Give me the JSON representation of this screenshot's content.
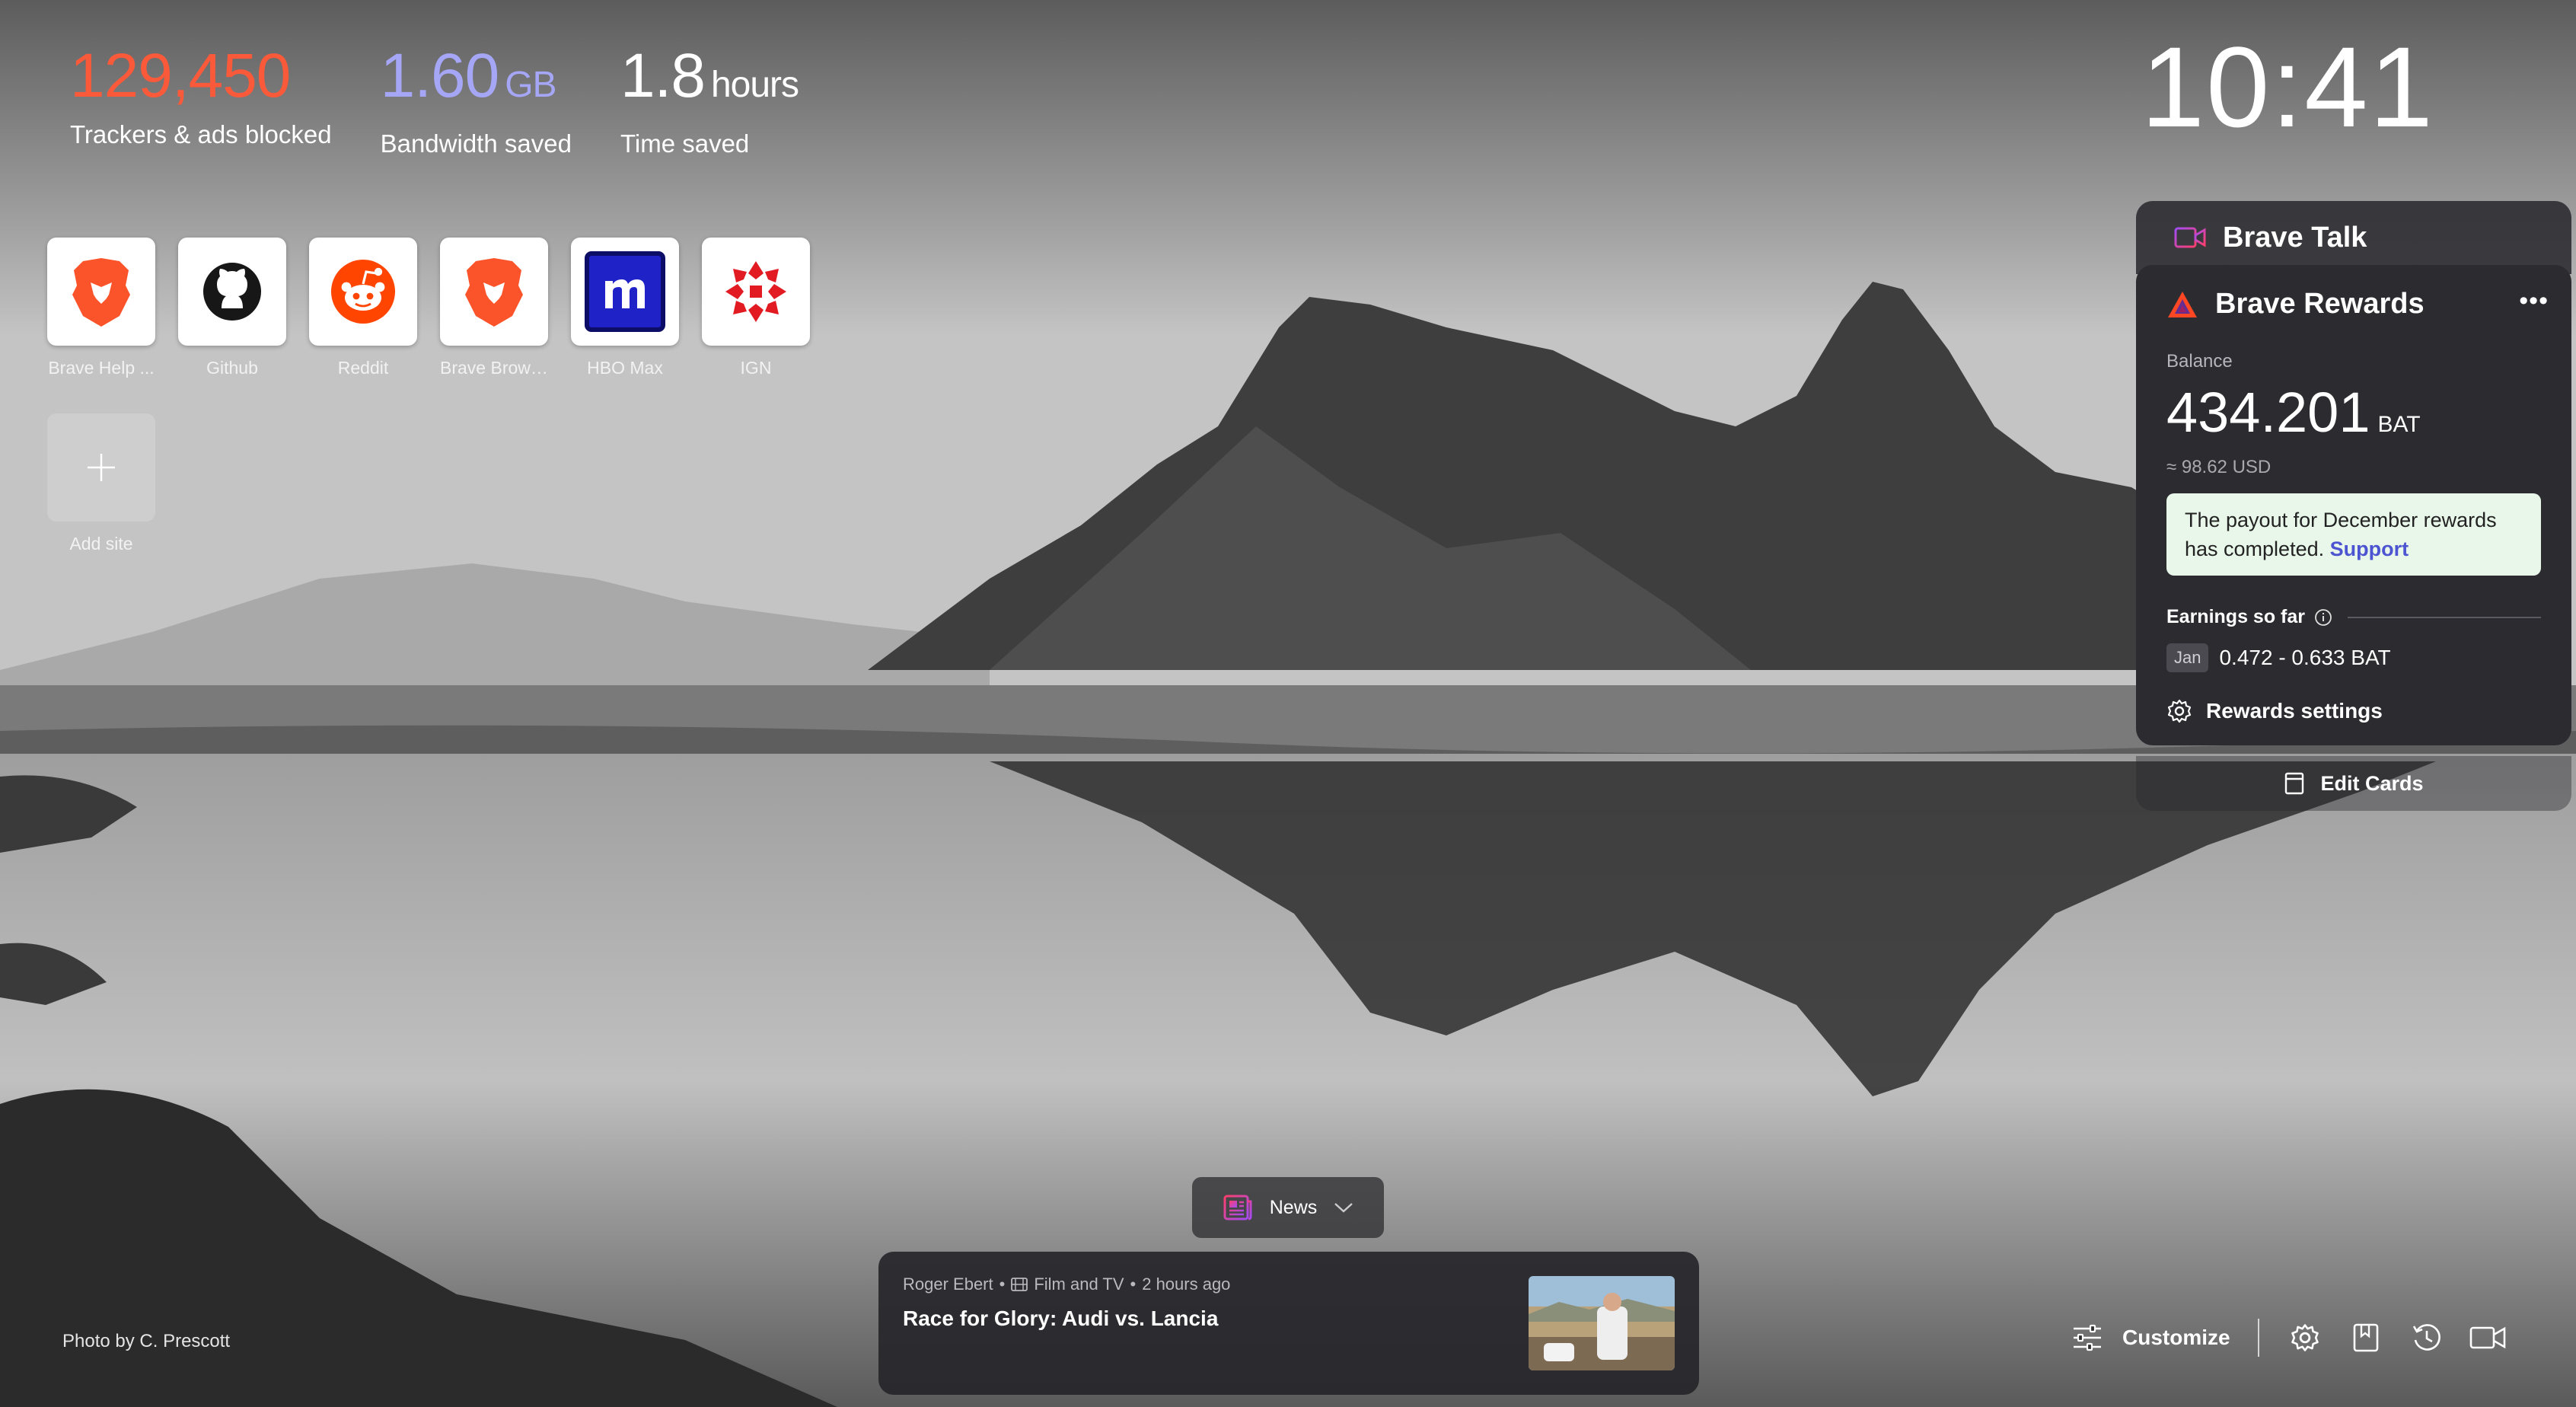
{
  "stats": [
    {
      "value": "129,450",
      "unit": "",
      "label": "Trackers & ads blocked",
      "color": "#fb5a3a"
    },
    {
      "value": "1.60",
      "unit": "GB",
      "label": "Bandwidth saved",
      "color": "#a5a6f6"
    },
    {
      "value": "1.8",
      "unit": "hours",
      "label": "Time saved",
      "color": "#ffffff"
    }
  ],
  "clock": {
    "time": "10:41"
  },
  "top_sites": [
    {
      "label": "Brave Help ...",
      "icon": "brave-lion-icon"
    },
    {
      "label": "Github",
      "icon": "github-icon"
    },
    {
      "label": "Reddit",
      "icon": "reddit-icon"
    },
    {
      "label": "Brave Brows...",
      "icon": "brave-lion-icon"
    },
    {
      "label": "HBO Max",
      "icon": "hbo-max-icon"
    },
    {
      "label": "IGN",
      "icon": "ign-icon"
    }
  ],
  "add_site": {
    "label": "Add site"
  },
  "brave_talk": {
    "title": "Brave Talk"
  },
  "brave_rewards": {
    "title": "Brave Rewards",
    "more": "•••",
    "balance_label": "Balance",
    "balance": "434.201",
    "balance_unit": "BAT",
    "usd": "≈ 98.62 USD",
    "notice_text": "The payout for December rewards has completed.",
    "notice_link": "Support",
    "earnings_label": "Earnings so far",
    "earnings_month": "Jan",
    "earnings_range": "0.472 - 0.633 BAT",
    "settings_label": "Rewards settings"
  },
  "edit_cards": {
    "label": "Edit Cards"
  },
  "news": {
    "button_label": "News",
    "card": {
      "source": "Roger Ebert",
      "category": "Film and TV",
      "age": "2 hours ago",
      "title": "Race for Glory: Audi vs. Lancia"
    }
  },
  "photo_credit": "Photo by C. Prescott",
  "bottom_bar": {
    "customize_label": "Customize"
  }
}
